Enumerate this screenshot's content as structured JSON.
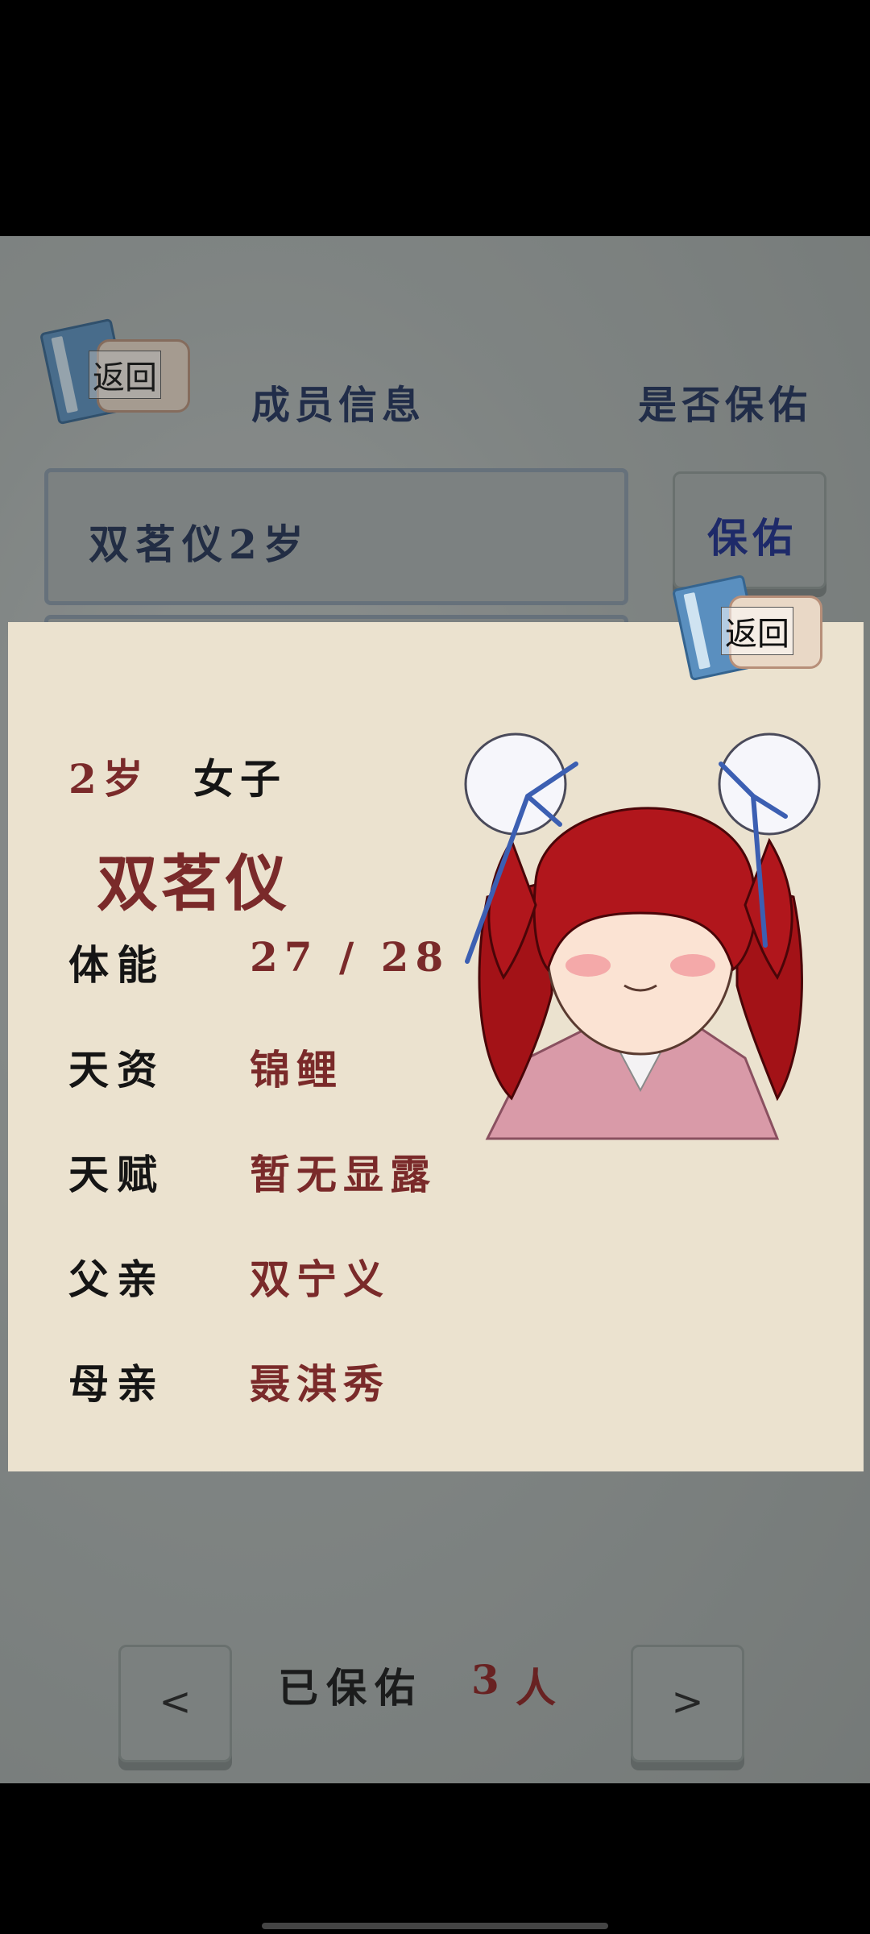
{
  "header": {
    "back_label": "返回",
    "member_info_label": "成员信息",
    "protect_question_label": "是否保佑"
  },
  "member_list": [
    {
      "name_age": "双茗仪2岁",
      "action_label": "保佑"
    }
  ],
  "popup": {
    "back_label": "返回",
    "age": "2岁",
    "gender": "女子",
    "name": "双茗仪",
    "rows": [
      {
        "label": "体能",
        "value": "27 / 28"
      },
      {
        "label": "天资",
        "value": "锦鲤"
      },
      {
        "label": "天赋",
        "value": "暂无显露"
      },
      {
        "label": "父亲",
        "value": "双宁义"
      },
      {
        "label": "母亲",
        "value": "聂淇秀"
      }
    ]
  },
  "footer": {
    "prev_label": "<",
    "next_label": ">",
    "protected_label": "已保佑",
    "protected_count": "3",
    "protected_unit": "人"
  }
}
